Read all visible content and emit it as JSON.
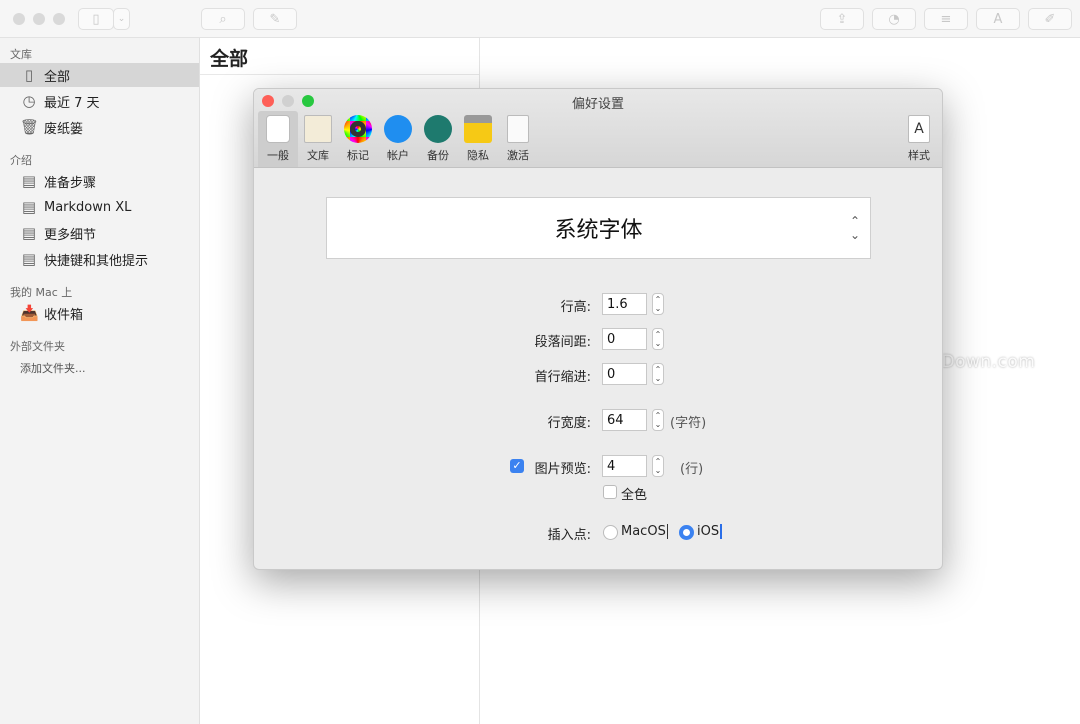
{
  "titlebar": {
    "buttons": [
      "sidebar-toggle",
      "chevron-down",
      "search",
      "compose",
      "share",
      "gauge",
      "list",
      "font-style",
      "attachment"
    ]
  },
  "sidebar": {
    "sections": [
      {
        "title": "文库",
        "items": [
          {
            "label": "全部",
            "icon": "book-icon",
            "selected": true
          },
          {
            "label": "最近 7 天",
            "icon": "clock-icon"
          },
          {
            "label": "废纸篓",
            "icon": "trash-icon"
          }
        ]
      },
      {
        "title": "介绍",
        "items": [
          {
            "label": "准备步骤",
            "icon": "document-icon"
          },
          {
            "label": "Markdown XL",
            "icon": "document-icon"
          },
          {
            "label": "更多细节",
            "icon": "document-icon"
          },
          {
            "label": "快捷键和其他提示",
            "icon": "document-icon"
          }
        ]
      },
      {
        "title": "我的 Mac 上",
        "items": [
          {
            "label": "收件箱",
            "icon": "inbox-icon"
          }
        ]
      },
      {
        "title": "外部文件夹",
        "items": [
          {
            "label": "添加文件夹...",
            "icon": ""
          }
        ]
      }
    ]
  },
  "middle": {
    "title": "全部"
  },
  "dialog": {
    "title": "偏好设置",
    "tabs": [
      {
        "label": "一般",
        "selected": true
      },
      {
        "label": "文库"
      },
      {
        "label": "标记"
      },
      {
        "label": "帐户"
      },
      {
        "label": "备份"
      },
      {
        "label": "隐私"
      },
      {
        "label": "激活"
      },
      {
        "label": "样式"
      }
    ],
    "font": "系统字体",
    "line_height": {
      "label": "行高:",
      "value": "1.6"
    },
    "paragraph_spacing": {
      "label": "段落间距:",
      "value": "0"
    },
    "first_indent": {
      "label": "首行缩进:",
      "value": "0"
    },
    "line_width": {
      "label": "行宽度:",
      "value": "64",
      "unit": "(字符)"
    },
    "image_preview": {
      "label": "图片预览:",
      "value": "4",
      "unit": "(行)",
      "checked": true
    },
    "full_color": {
      "label": "全色",
      "checked": false
    },
    "insertion_point": {
      "label": "插入点:",
      "options": [
        "MacOS",
        "iOS"
      ],
      "selected": "iOS"
    }
  },
  "watermark": "www.MacDown.com",
  "colors": {
    "accent": "#3b82f0",
    "close": "#fe5f57",
    "zoom": "#28c840"
  }
}
